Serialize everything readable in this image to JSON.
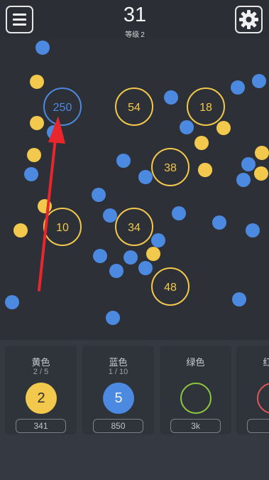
{
  "header": {
    "menu_icon": "hamburger-menu-icon",
    "score": "31",
    "level_label": "等级",
    "level_value": "2",
    "settings_icon": "gear-icon"
  },
  "colors": {
    "blue": "#4b8ae0",
    "yellow": "#f2c94c",
    "green": "#8dc63f",
    "red": "#e0555c",
    "arrow": "#e8262b"
  },
  "game": {
    "blocks": [
      {
        "value": "250",
        "color": "blue"
      },
      {
        "value": "54",
        "color": "yellow"
      },
      {
        "value": "18",
        "color": "yellow"
      },
      {
        "value": "38",
        "color": "yellow"
      },
      {
        "value": "10",
        "color": "yellow"
      },
      {
        "value": "34",
        "color": "yellow"
      },
      {
        "value": "48",
        "color": "yellow"
      }
    ],
    "ball_colors": [
      "blue",
      "yellow",
      "yellow",
      "blue",
      "blue",
      "blue",
      "blue",
      "yellow",
      "yellow",
      "blue",
      "blue",
      "blue",
      "blue",
      "yellow",
      "yellow",
      "yellow",
      "yellow",
      "yellow",
      "blue",
      "blue",
      "blue",
      "blue",
      "blue",
      "blue",
      "blue",
      "blue",
      "blue",
      "yellow",
      "blue",
      "blue",
      "blue",
      "blue",
      "blue",
      "blue"
    ]
  },
  "shop": [
    {
      "title": "黄色",
      "count": "2 / 5",
      "ball_label": "2",
      "cost": "341",
      "color": "yellow"
    },
    {
      "title": "蓝色",
      "count": "1 / 10",
      "ball_label": "5",
      "cost": "850",
      "color": "blue"
    },
    {
      "title": "绿色",
      "count": "",
      "ball_label": "",
      "cost": "3k",
      "color": "green"
    },
    {
      "title": "红色",
      "count": "",
      "ball_label": "",
      "cost": "",
      "color": "red"
    }
  ]
}
